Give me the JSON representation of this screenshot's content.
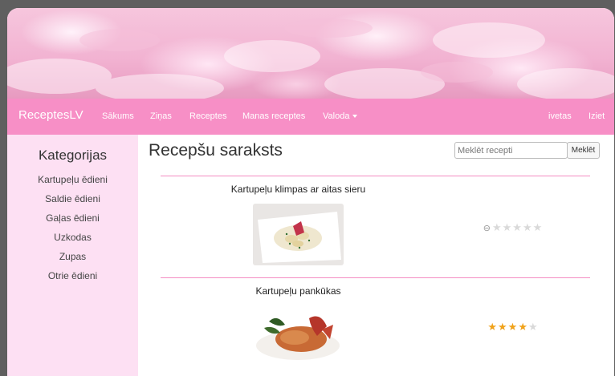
{
  "navbar": {
    "brand": "ReceptesLV",
    "items": [
      "Sākums",
      "Ziņas",
      "Receptes",
      "Manas receptes"
    ],
    "language_label": "Valoda",
    "user": "ivetas",
    "logout": "Iziet"
  },
  "sidebar": {
    "title": "Kategorijas",
    "categories": [
      "Kartupeļu ēdieni",
      "Saldie ēdieni",
      "Gaļas ēdieni",
      "Uzkodas",
      "Zupas",
      "Otrie ēdieni"
    ]
  },
  "main": {
    "title": "Recepšu saraksts",
    "search": {
      "placeholder": "Meklēt recepti",
      "button": "Meklēt"
    },
    "recipes": [
      {
        "title": "Kartupeļu klimpas ar aitas sieru",
        "rating": 0,
        "max_rating": 5
      },
      {
        "title": "Kartupeļu pankūkas",
        "rating": 4,
        "max_rating": 5
      }
    ]
  },
  "colors": {
    "accent": "#f78fc6",
    "sidebar_bg": "#fde0f3",
    "star": "#f0a21a",
    "frame": "#5f5f5f"
  },
  "icons": {
    "star": "star-icon",
    "cancel_rating": "cancel-rating-icon",
    "dropdown": "caret-down-icon"
  }
}
